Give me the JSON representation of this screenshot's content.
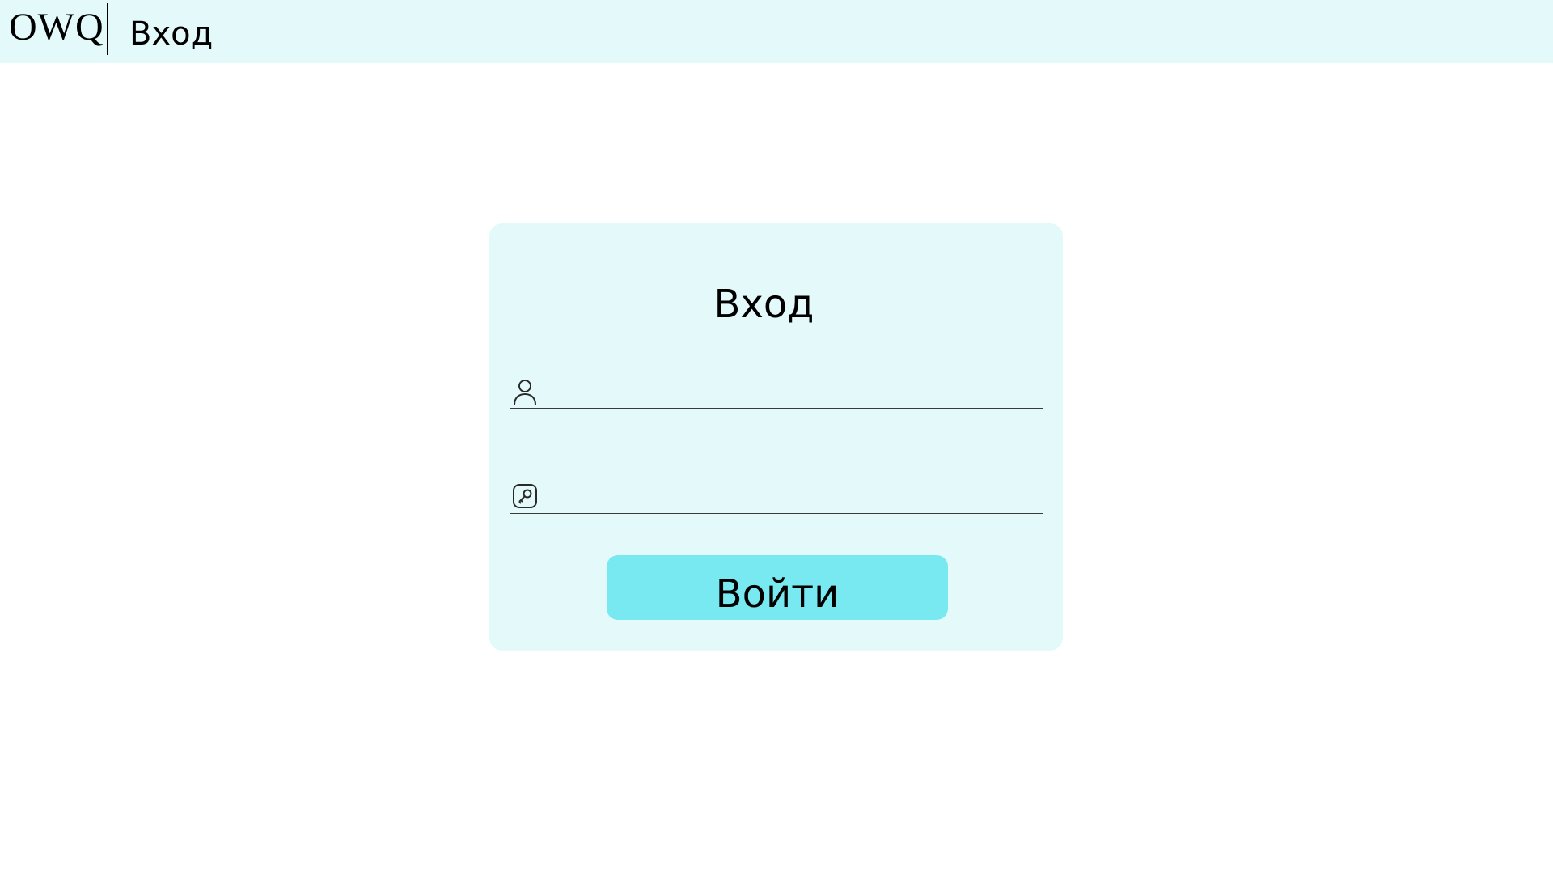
{
  "header": {
    "logo": "OWQ",
    "title": "Вход"
  },
  "login_card": {
    "title": "Вход",
    "username_field": {
      "icon": "user-icon",
      "value": "",
      "placeholder": ""
    },
    "password_field": {
      "icon": "key-icon",
      "value": "",
      "placeholder": ""
    },
    "submit_label": "Войти"
  },
  "colors": {
    "header_bg": "#e3f9fa",
    "card_bg": "#e3f9fa",
    "button_bg": "#78e9f0",
    "page_bg": "#ffffff"
  }
}
